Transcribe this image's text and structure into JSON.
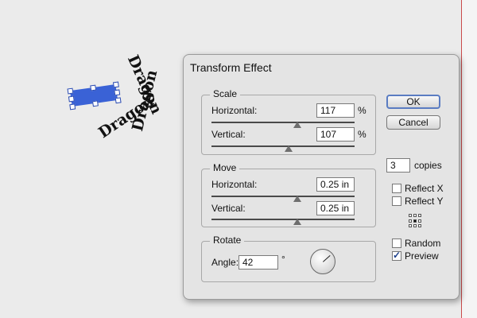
{
  "artwork": {
    "word": "Dragon"
  },
  "dialog": {
    "title": "Transform Effect",
    "scale": {
      "label": "Scale",
      "horizontal_label": "Horizontal:",
      "horizontal_value": "117",
      "horizontal_unit": "%",
      "vertical_label": "Vertical:",
      "vertical_value": "107",
      "vertical_unit": "%"
    },
    "move": {
      "label": "Move",
      "horizontal_label": "Horizontal:",
      "horizontal_value": "0.25 in",
      "vertical_label": "Vertical:",
      "vertical_value": "0.25 in"
    },
    "rotate": {
      "label": "Rotate",
      "angle_label": "Angle:",
      "angle_value": "42",
      "angle_unit": "°"
    },
    "buttons": {
      "ok": "OK",
      "cancel": "Cancel"
    },
    "copies": {
      "value": "3",
      "label": "copies"
    },
    "options": {
      "reflect_x": "Reflect X",
      "reflect_y": "Reflect Y",
      "random": "Random",
      "preview": "Preview",
      "preview_checked": true,
      "reflect_x_checked": false,
      "reflect_y_checked": false,
      "random_checked": false
    }
  },
  "colors": {
    "selection": "#3a62d6",
    "artboard_edge": "#c94a4a",
    "dialog_bg": "#e4e4e4"
  }
}
